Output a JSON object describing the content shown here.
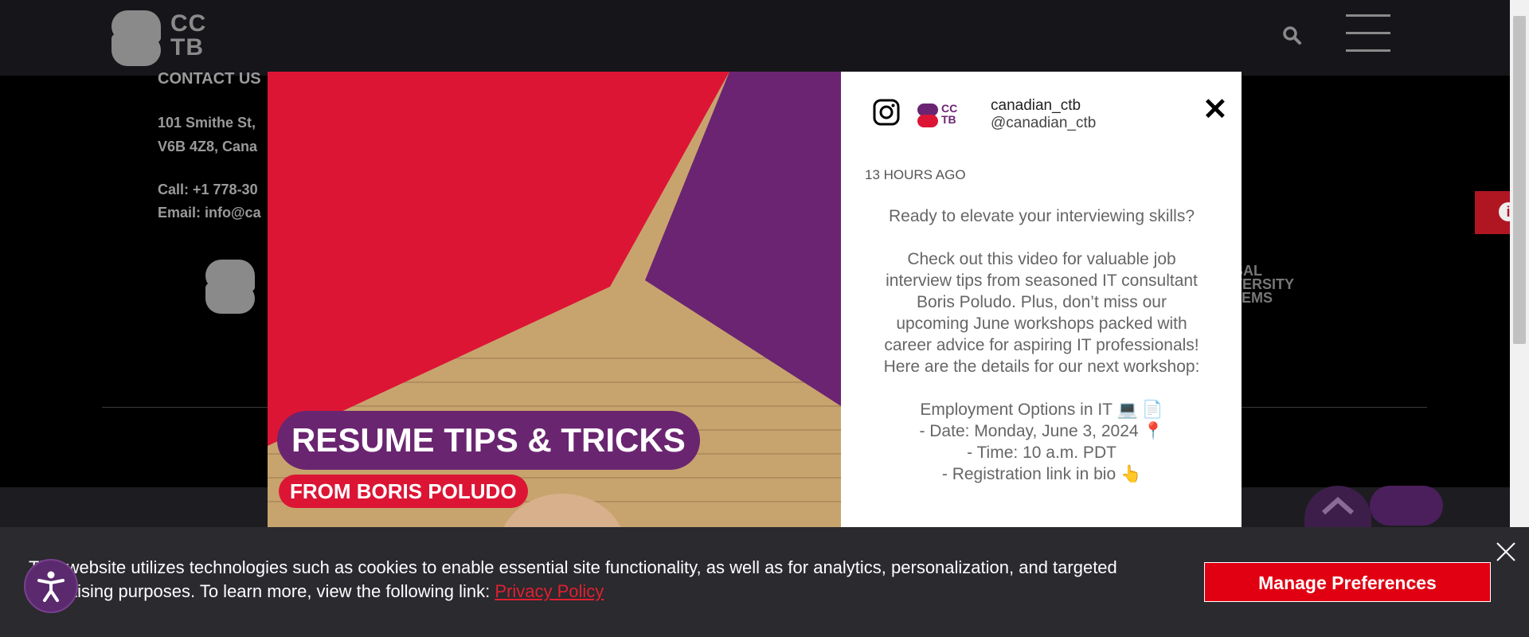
{
  "header": {
    "logo_text_line1": "CC",
    "logo_text_line2": "TB",
    "search_icon": "search-icon",
    "menu_icon": "hamburger-icon"
  },
  "footer": {
    "contact_heading": "CONTACT US",
    "address_line1": "101 Smithe St,",
    "address_line2": "V6B 4Z8, Cana",
    "call": "Call: +1 778-30",
    "email": "Email: info@ca",
    "partner_logo_line1": "BAL",
    "partner_logo_line2": "VERSITY",
    "partner_logo_line3": "TEMS"
  },
  "modal": {
    "image": {
      "headline": "RESUME TIPS & TRICKS",
      "subheadline": "FROM BORIS POLUDO"
    },
    "account_name": "canadian_ctb",
    "account_handle": "@canadian_ctb",
    "time_ago": "13 HOURS AGO",
    "caption_p1": "Ready to elevate your interviewing skills?",
    "caption_p2": "Check out this video for valuable job interview tips from seasoned IT consultant Boris Poludo. Plus, don’t miss our upcoming June workshops packed with career advice for aspiring IT professionals! Here are the details for our next workshop:",
    "caption_l1": "Employment Options in IT 💻 📄",
    "caption_l2": "- Date: Monday, June 3, 2024 📍",
    "caption_l3": "- Time: 10 a.m. PDT",
    "caption_l4": "- Registration link in bio 👆",
    "close_icon": "close-icon",
    "mini_logo_line1": "CC",
    "mini_logo_line2": "TB"
  },
  "cookie_banner": {
    "text_part1": "This website utilizes technologies such as cookies to enable essential site functionality, as well as for analytics, personalization, and targeted advertising purposes. To learn more, view the following link: ",
    "privacy_link": "Privacy Policy",
    "manage_button": "Manage Preferences"
  },
  "colors": {
    "brand_red": "#e00012",
    "brand_purple": "#6a2570",
    "topbar_bg": "#16161a"
  }
}
